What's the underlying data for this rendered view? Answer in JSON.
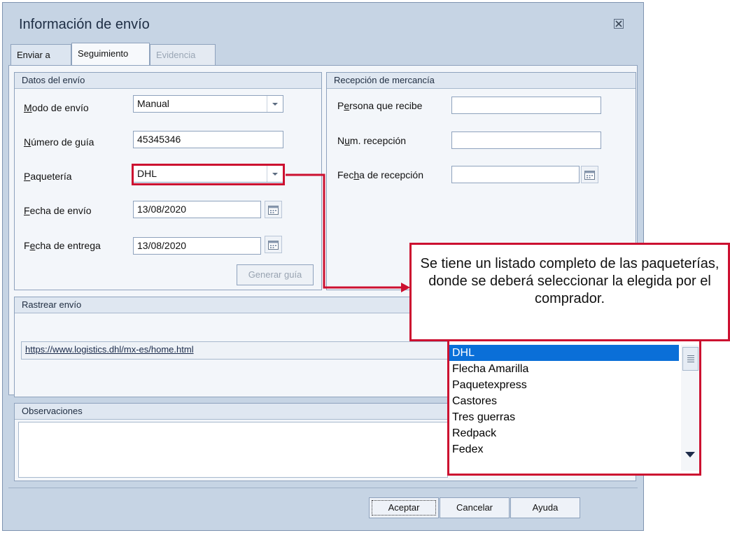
{
  "dialog": {
    "title": "Información de envío",
    "close_icon": "close-icon"
  },
  "tabs": [
    {
      "label": "Enviar a",
      "state": "normal"
    },
    {
      "label": "Seguimiento",
      "state": "active"
    },
    {
      "label": "Evidencia",
      "state": "disabled"
    }
  ],
  "datos_envio": {
    "header": "Datos del envío",
    "modo_label": "Modo de envío",
    "modo_value": "Manual",
    "guia_label": "Número de guía",
    "guia_value": "45345346",
    "paqueteria_label": "Paquetería",
    "paqueteria_value": "DHL",
    "fecha_envio_label": "Fecha de envío",
    "fecha_envio_value": "13/08/2020",
    "fecha_entrega_label": "Fecha de entrega",
    "fecha_entrega_value": "13/08/2020",
    "generar_label": "Generar guía"
  },
  "recepcion": {
    "header": "Recepción de mercancía",
    "persona_label": "Persona que recibe",
    "persona_value": "",
    "num_label": "Num. recepción",
    "num_value": "",
    "fecha_label": "Fecha de recepción",
    "fecha_value": ""
  },
  "rastrear": {
    "header": "Rastrear envío",
    "url": "https://www.logistics.dhl/mx-es/home.html"
  },
  "observaciones": {
    "header": "Observaciones",
    "value": ""
  },
  "buttons": {
    "aceptar": "Aceptar",
    "cancelar": "Cancelar",
    "ayuda": "Ayuda"
  },
  "callout": {
    "text": "Se tiene un listado completo de las paqueterías, donde se deberá seleccionar la elegida por el comprador.",
    "accent": "#cc1030"
  },
  "dropdown_list": {
    "items": [
      "DHL",
      "Flecha Amarilla",
      "Paquetexpress",
      "Castores",
      "Tres guerras",
      "Redpack",
      "Fedex"
    ],
    "selected": "DHL"
  }
}
